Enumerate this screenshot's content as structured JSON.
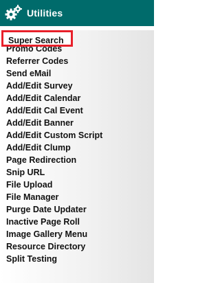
{
  "header": {
    "title": "Utilities",
    "icon": "gears-icon"
  },
  "menu": {
    "items": [
      {
        "label": "Super Search",
        "highlighted": true
      },
      {
        "label": "Promo Codes"
      },
      {
        "label": "Referrer Codes"
      },
      {
        "label": "Send eMail"
      },
      {
        "label": "Add/Edit Survey"
      },
      {
        "label": "Add/Edit Calendar"
      },
      {
        "label": "Add/Edit Cal Event"
      },
      {
        "label": "Add/Edit Banner"
      },
      {
        "label": "Add/Edit Custom Script"
      },
      {
        "label": "Add/Edit Clump"
      },
      {
        "label": "Page Redirection"
      },
      {
        "label": "Snip URL"
      },
      {
        "label": "File Upload"
      },
      {
        "label": "File Manager"
      },
      {
        "label": "Purge Date Updater"
      },
      {
        "label": "Inactive Page Roll"
      },
      {
        "label": "Image Gallery Menu"
      },
      {
        "label": "Resource Directory"
      },
      {
        "label": "Split Testing"
      }
    ]
  },
  "colors": {
    "header_bg": "#006b6b",
    "highlight_border": "#e8202a"
  }
}
